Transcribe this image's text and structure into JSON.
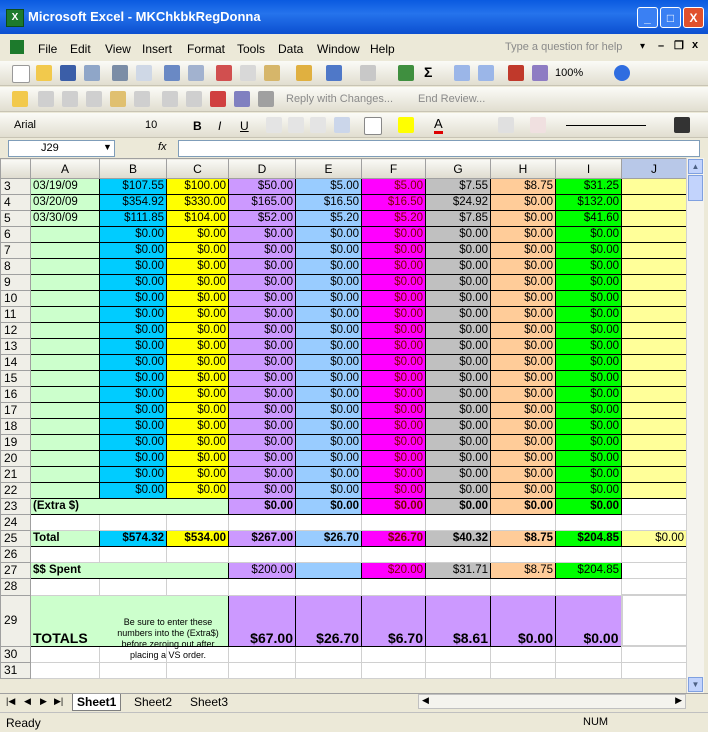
{
  "window": {
    "title": "Microsoft Excel - MKChkbkRegDonna",
    "app_icon": "excel-icon",
    "xl_badge": "X"
  },
  "window_buttons": {
    "minimize": "_",
    "maximize": "□",
    "close": "X"
  },
  "menu": [
    "File",
    "Edit",
    "View",
    "Insert",
    "Format",
    "Tools",
    "Data",
    "Window",
    "Help"
  ],
  "menu_help_box": "Type a question for help",
  "toolbar": {
    "zoom": "100%",
    "sigma": "Σ",
    "reply": "Reply with Changes...",
    "end_review": "End Review...",
    "font": "Arial",
    "size": "10",
    "bold": "B",
    "italic": "I",
    "underline": "U",
    "font_color_glyph": "A"
  },
  "namebox": "J29",
  "fx": "fx",
  "columns": [
    "A",
    "B",
    "C",
    "D",
    "E",
    "F",
    "G",
    "H",
    "I",
    "J"
  ],
  "rows": [
    {
      "n": "3",
      "type": "data",
      "cells": [
        "03/19/09",
        "$107.55",
        "$100.00",
        "$50.00",
        "$5.00",
        "$5.00",
        "$7.55",
        "$8.75",
        "$31.25",
        ""
      ]
    },
    {
      "n": "4",
      "type": "data",
      "cells": [
        "03/20/09",
        "$354.92",
        "$330.00",
        "$165.00",
        "$16.50",
        "$16.50",
        "$24.92",
        "$0.00",
        "$132.00",
        ""
      ]
    },
    {
      "n": "5",
      "type": "data",
      "cells": [
        "03/30/09",
        "$111.85",
        "$104.00",
        "$52.00",
        "$5.20",
        "$5.20",
        "$7.85",
        "$0.00",
        "$41.60",
        ""
      ]
    },
    {
      "n": "6",
      "type": "data",
      "cells": [
        "",
        "$0.00",
        "$0.00",
        "$0.00",
        "$0.00",
        "$0.00",
        "$0.00",
        "$0.00",
        "$0.00",
        ""
      ]
    },
    {
      "n": "7",
      "type": "data",
      "cells": [
        "",
        "$0.00",
        "$0.00",
        "$0.00",
        "$0.00",
        "$0.00",
        "$0.00",
        "$0.00",
        "$0.00",
        ""
      ]
    },
    {
      "n": "8",
      "type": "data",
      "cells": [
        "",
        "$0.00",
        "$0.00",
        "$0.00",
        "$0.00",
        "$0.00",
        "$0.00",
        "$0.00",
        "$0.00",
        ""
      ]
    },
    {
      "n": "9",
      "type": "data",
      "cells": [
        "",
        "$0.00",
        "$0.00",
        "$0.00",
        "$0.00",
        "$0.00",
        "$0.00",
        "$0.00",
        "$0.00",
        ""
      ]
    },
    {
      "n": "10",
      "type": "data",
      "cells": [
        "",
        "$0.00",
        "$0.00",
        "$0.00",
        "$0.00",
        "$0.00",
        "$0.00",
        "$0.00",
        "$0.00",
        ""
      ]
    },
    {
      "n": "11",
      "type": "data",
      "cells": [
        "",
        "$0.00",
        "$0.00",
        "$0.00",
        "$0.00",
        "$0.00",
        "$0.00",
        "$0.00",
        "$0.00",
        ""
      ]
    },
    {
      "n": "12",
      "type": "data",
      "cells": [
        "",
        "$0.00",
        "$0.00",
        "$0.00",
        "$0.00",
        "$0.00",
        "$0.00",
        "$0.00",
        "$0.00",
        ""
      ]
    },
    {
      "n": "13",
      "type": "data",
      "cells": [
        "",
        "$0.00",
        "$0.00",
        "$0.00",
        "$0.00",
        "$0.00",
        "$0.00",
        "$0.00",
        "$0.00",
        ""
      ]
    },
    {
      "n": "14",
      "type": "data",
      "cells": [
        "",
        "$0.00",
        "$0.00",
        "$0.00",
        "$0.00",
        "$0.00",
        "$0.00",
        "$0.00",
        "$0.00",
        ""
      ]
    },
    {
      "n": "15",
      "type": "data",
      "cells": [
        "",
        "$0.00",
        "$0.00",
        "$0.00",
        "$0.00",
        "$0.00",
        "$0.00",
        "$0.00",
        "$0.00",
        ""
      ]
    },
    {
      "n": "16",
      "type": "data",
      "cells": [
        "",
        "$0.00",
        "$0.00",
        "$0.00",
        "$0.00",
        "$0.00",
        "$0.00",
        "$0.00",
        "$0.00",
        ""
      ]
    },
    {
      "n": "17",
      "type": "data",
      "cells": [
        "",
        "$0.00",
        "$0.00",
        "$0.00",
        "$0.00",
        "$0.00",
        "$0.00",
        "$0.00",
        "$0.00",
        ""
      ]
    },
    {
      "n": "18",
      "type": "data",
      "cells": [
        "",
        "$0.00",
        "$0.00",
        "$0.00",
        "$0.00",
        "$0.00",
        "$0.00",
        "$0.00",
        "$0.00",
        ""
      ]
    },
    {
      "n": "19",
      "type": "data",
      "cells": [
        "",
        "$0.00",
        "$0.00",
        "$0.00",
        "$0.00",
        "$0.00",
        "$0.00",
        "$0.00",
        "$0.00",
        ""
      ]
    },
    {
      "n": "20",
      "type": "data",
      "cells": [
        "",
        "$0.00",
        "$0.00",
        "$0.00",
        "$0.00",
        "$0.00",
        "$0.00",
        "$0.00",
        "$0.00",
        ""
      ]
    },
    {
      "n": "21",
      "type": "data",
      "cells": [
        "",
        "$0.00",
        "$0.00",
        "$0.00",
        "$0.00",
        "$0.00",
        "$0.00",
        "$0.00",
        "$0.00",
        ""
      ]
    },
    {
      "n": "22",
      "type": "data",
      "cells": [
        "",
        "$0.00",
        "$0.00",
        "$0.00",
        "$0.00",
        "$0.00",
        "$0.00",
        "$0.00",
        "$0.00",
        ""
      ]
    },
    {
      "n": "23",
      "type": "extra",
      "label": "(Extra $)",
      "cells": [
        "$0.00",
        "$0.00",
        "$0.00",
        "$0.00",
        "$0.00",
        "$0.00"
      ]
    },
    {
      "n": "24",
      "type": "blank"
    },
    {
      "n": "25",
      "type": "total",
      "cells": [
        "Total",
        "$574.32",
        "$534.00",
        "$267.00",
        "$26.70",
        "$26.70",
        "$40.32",
        "$8.75",
        "$204.85",
        "$0.00"
      ]
    },
    {
      "n": "26",
      "type": "blank"
    },
    {
      "n": "27",
      "type": "spent",
      "label": "$$ Spent",
      "cells": [
        "$200.00",
        "",
        "$20.00",
        "$31.71",
        "$8.75",
        "$204.85"
      ]
    },
    {
      "n": "28",
      "type": "blank"
    },
    {
      "n": "29",
      "type": "totals",
      "label": "TOTALS",
      "cells": [
        "$67.00",
        "$26.70",
        "$6.70",
        "$8.61",
        "$0.00",
        "$0.00"
      ]
    },
    {
      "n": "30",
      "type": "blank"
    },
    {
      "n": "31",
      "type": "blank"
    }
  ],
  "note": "Be sure to enter these numbers into the (Extra$) before zeroing out after placing a VS order.",
  "sheets": [
    "Sheet1",
    "Sheet2",
    "Sheet3"
  ],
  "status": {
    "ready": "Ready",
    "num": "NUM"
  }
}
